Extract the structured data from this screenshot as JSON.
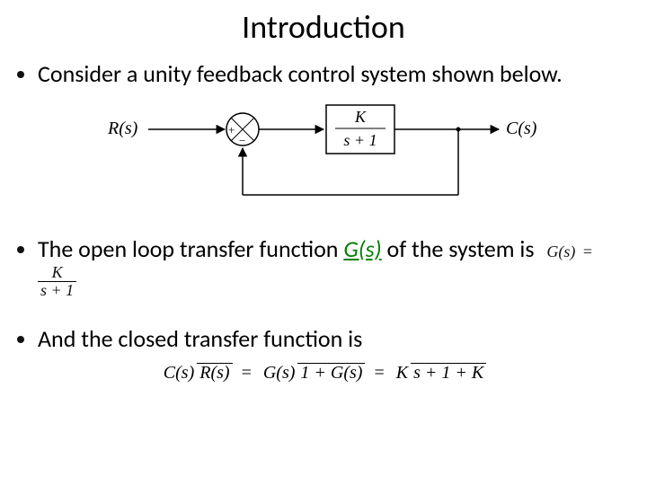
{
  "title": "Introduction",
  "bullets": {
    "b1": "Consider a unity feedback control system shown below.",
    "b2_prefix": "The open loop transfer function ",
    "b2_gs": "G(s)",
    "b2_suffix": " of the system is",
    "b3": "And the closed transfer function is"
  },
  "diagram": {
    "input_label": "R(s)",
    "output_label": "C(s)",
    "sum_plus": "+",
    "sum_minus": "−",
    "block_num": "K",
    "block_den": "s + 1"
  },
  "open_loop_eq": {
    "lhs": "G(s)",
    "eq": "=",
    "num": "K",
    "den": "s + 1"
  },
  "closed_loop_eq": {
    "lhs_num": "C(s)",
    "lhs_den": "R(s)",
    "eq": "=",
    "mid_num": "G(s)",
    "mid_den": "1 + G(s)",
    "rhs_num": "K",
    "rhs_den": "s + 1 + K"
  }
}
